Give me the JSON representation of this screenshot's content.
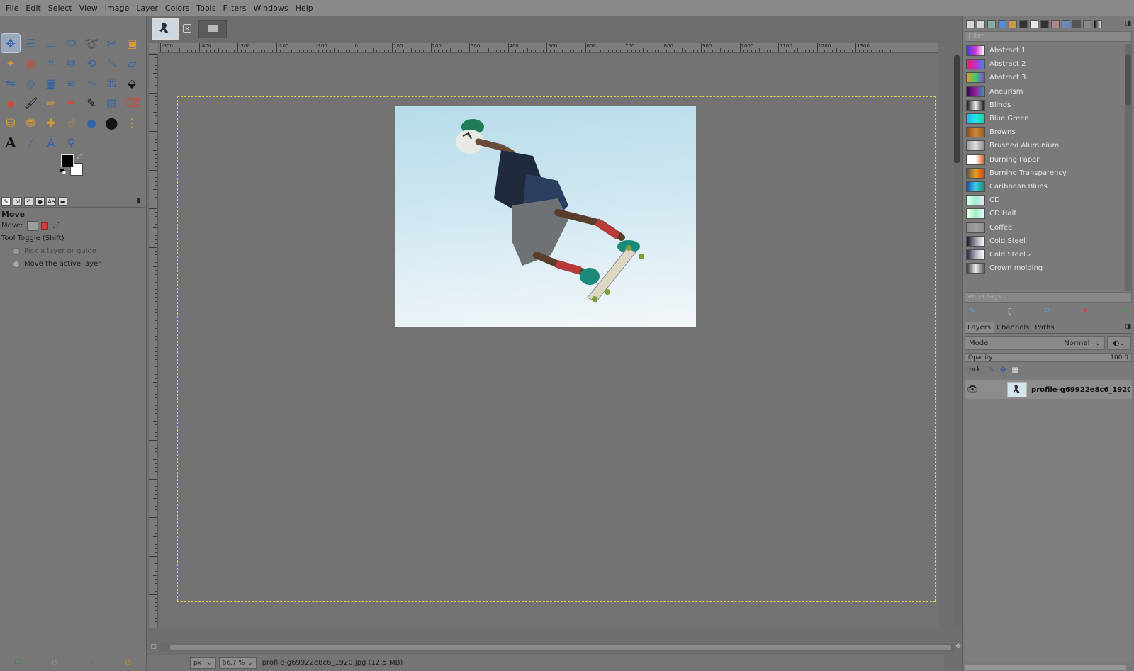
{
  "menu": [
    "File",
    "Edit",
    "Select",
    "View",
    "Image",
    "Layer",
    "Colors",
    "Tools",
    "Filters",
    "Windows",
    "Help"
  ],
  "colors": {
    "foreground": "#000000",
    "background": "#ffffff",
    "selection_outline": "#d8d44d",
    "accent_blue": "#2f64a8"
  },
  "tool_options": {
    "title": "Move",
    "move_label": "Move:",
    "toggle_label": "Tool Toggle  (Shift)",
    "radio_pick": "Pick a layer or guide",
    "radio_active": "Move the active layer"
  },
  "ruler": {
    "labels": [
      "-500",
      "-400",
      "-300",
      "-200",
      "-100",
      "0",
      "100",
      "200",
      "300",
      "400",
      "500",
      "600",
      "700",
      "800",
      "900",
      "1000",
      "1100",
      "1200",
      "1300"
    ]
  },
  "status": {
    "unit": "px",
    "zoom": "66.7 %",
    "file": "profile-g69922e8c6_1920.jpg (12,5 MB)"
  },
  "gradients": {
    "filter_placeholder": "Filter",
    "tags_placeholder": "enter tags",
    "items": [
      {
        "name": "Abstract 1",
        "colors": [
          "#3a3ae8",
          "#d03ad0",
          "#ffffff"
        ]
      },
      {
        "name": "Abstract 2",
        "colors": [
          "#e8245a",
          "#c42ad0",
          "#3a8af0"
        ]
      },
      {
        "name": "Abstract 3",
        "colors": [
          "#e89a20",
          "#3ad070",
          "#8a40e0"
        ]
      },
      {
        "name": "Aneurism",
        "colors": [
          "#2a0a4a",
          "#9a1aa0",
          "#30a0b0"
        ]
      },
      {
        "name": "Blinds",
        "colors": [
          "#111111",
          "#eeeeee",
          "#111111"
        ]
      },
      {
        "name": "Blue Green",
        "colors": [
          "#20b0f0",
          "#20e8e8",
          "#1ad0a0"
        ]
      },
      {
        "name": "Browns",
        "colors": [
          "#8a4a1a",
          "#d08a3a",
          "#a05a20"
        ]
      },
      {
        "name": "Brushed Aluminium",
        "colors": [
          "#9a9a9a",
          "#e0e0e0",
          "#8a8a8a"
        ]
      },
      {
        "name": "Burning Paper",
        "colors": [
          "#ffffff",
          "#ffffff",
          "#e05a10"
        ]
      },
      {
        "name": "Burning Transparency",
        "colors": [
          "#555555",
          "#e8a020",
          "#d04010"
        ]
      },
      {
        "name": "Caribbean Blues",
        "colors": [
          "#1a4ab0",
          "#3ad0e0",
          "#1a8a7a"
        ]
      },
      {
        "name": "CD",
        "colors": [
          "#e0ffe8",
          "#a0f0d0",
          "#f0e0ff"
        ]
      },
      {
        "name": "CD Half",
        "colors": [
          "#f0fff0",
          "#a0f0c0",
          "#e0f8ff"
        ]
      },
      {
        "name": "Coffee",
        "colors": [
          "#8a8a8a",
          "#a0a0a0",
          "#8a8a8a"
        ]
      },
      {
        "name": "Cold Steel",
        "colors": [
          "#111122",
          "#9a9aa8",
          "#ffffff"
        ]
      },
      {
        "name": "Cold Steel 2",
        "colors": [
          "#222233",
          "#b0b0c0",
          "#ffffff"
        ]
      },
      {
        "name": "Crown molding",
        "colors": [
          "#333333",
          "#eeeeee",
          "#555555"
        ]
      }
    ]
  },
  "layers_tabs": [
    "Layers",
    "Channels",
    "Paths"
  ],
  "layers": {
    "mode_label": "Mode",
    "mode_value": "Normal",
    "opacity_label": "Opacity",
    "opacity_value": "100.0",
    "lock_label": "Lock:",
    "layer_name": "profile-g69922e8c6_1920."
  }
}
